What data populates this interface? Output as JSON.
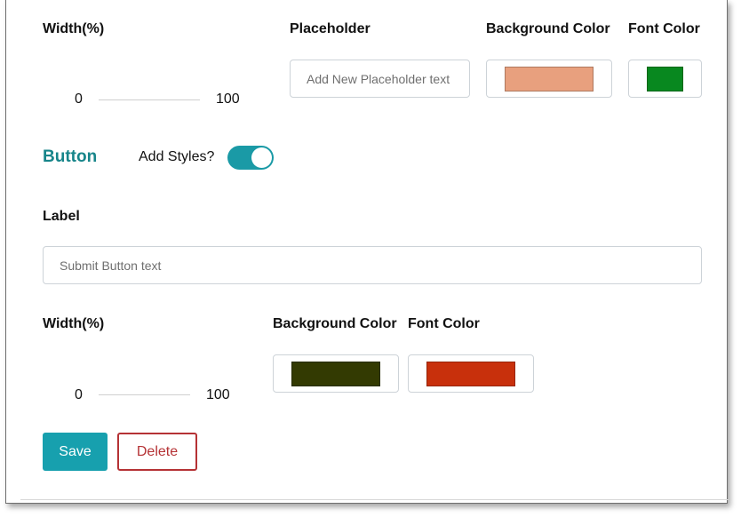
{
  "input_section": {
    "width": {
      "label": "Width(%)",
      "min": "0",
      "max": "100"
    },
    "placeholder": {
      "label": "Placeholder",
      "placeholder": "Add New Placeholder text"
    },
    "background_color": {
      "label": "Background Color",
      "value": "#e8a07e"
    },
    "font_color": {
      "label": "Font Color",
      "value": "#08881f"
    }
  },
  "button_section": {
    "title": "Button",
    "add_styles_label": "Add Styles?",
    "add_styles_on": true,
    "label_field": {
      "label": "Label",
      "placeholder": "Submit Button text"
    },
    "width": {
      "label": "Width(%)",
      "min": "0",
      "max": "100"
    },
    "background_color": {
      "label": "Background Color",
      "value": "#333a02"
    },
    "font_color": {
      "label": "Font Color",
      "value": "#c8300c"
    }
  },
  "actions": {
    "save_label": "Save",
    "delete_label": "Delete"
  },
  "colors": {
    "accent": "#17a0ae",
    "danger": "#b53235",
    "section_title": "#17858a"
  }
}
